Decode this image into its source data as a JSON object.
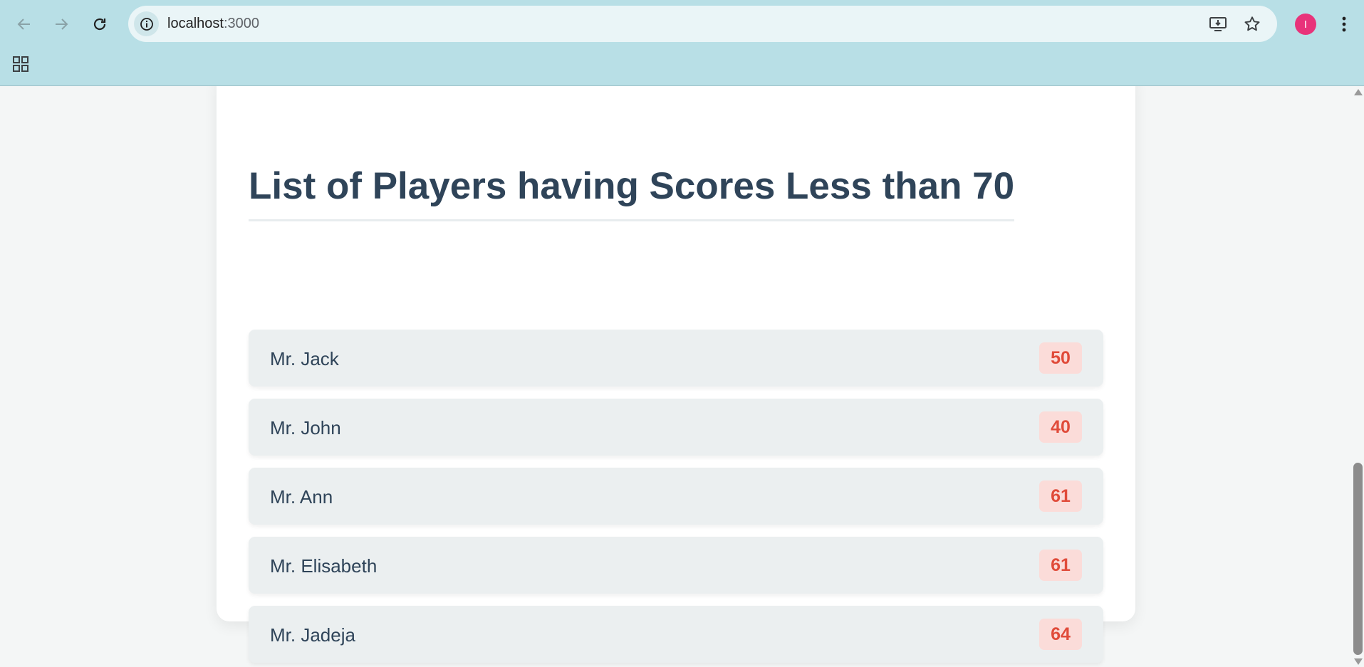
{
  "browser": {
    "url_host": "localhost",
    "url_port": ":3000",
    "profile_initial": "I",
    "icons": [
      "back-icon",
      "forward-icon",
      "reload-icon",
      "site-info-icon",
      "install-app-icon",
      "bookmark-star-icon",
      "menu-dots-icon",
      "apps-grid-icon"
    ],
    "colors": {
      "toolbar": "#b8dfe6",
      "omnibox": "#eaf5f7",
      "avatar": "#e8337a"
    }
  },
  "page": {
    "title": "List of Players having Scores Less than 70",
    "players": [
      {
        "name": "Mr. Jack",
        "score": "50"
      },
      {
        "name": "Mr. John",
        "score": "40"
      },
      {
        "name": "Mr. Ann",
        "score": "61"
      },
      {
        "name": "Mr. Elisabeth",
        "score": "61"
      },
      {
        "name": "Mr. Jadeja",
        "score": "64"
      }
    ],
    "colors": {
      "heading": "#2f4459",
      "row_bg": "#ebeff0",
      "score_bg": "#fbdcd9",
      "score_text": "#e04b3a"
    }
  }
}
